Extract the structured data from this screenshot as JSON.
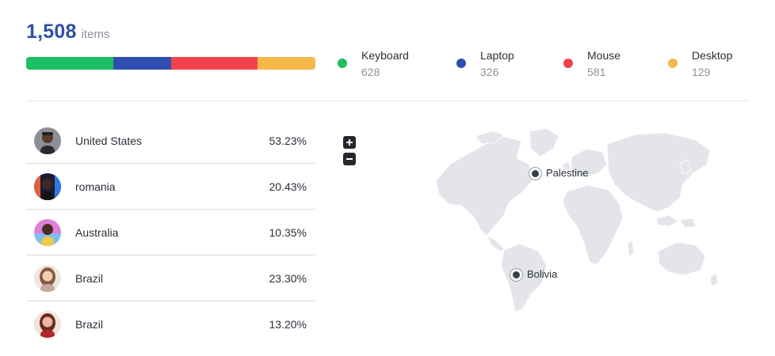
{
  "summary": {
    "total": "1,508",
    "unit": "items"
  },
  "categories": [
    {
      "label": "Keyboard",
      "count": "628",
      "color": "#1cbf63",
      "share": 0.3
    },
    {
      "label": "Laptop",
      "count": "326",
      "color": "#2e4fb0",
      "share": 0.2
    },
    {
      "label": "Mouse",
      "count": "581",
      "color": "#f2434d",
      "share": 0.3
    },
    {
      "label": "Desktop",
      "count": "129",
      "color": "#f6b84b",
      "share": 0.2
    }
  ],
  "countries": [
    {
      "name": "United States",
      "percent": "53.23%",
      "avatar": "avatar-man-gray"
    },
    {
      "name": "romania",
      "percent": "20.43%",
      "avatar": "avatar-man-neon"
    },
    {
      "name": "Australia",
      "percent": "10.35%",
      "avatar": "avatar-man-pink"
    },
    {
      "name": "Brazil",
      "percent": "23.30%",
      "avatar": "avatar-woman-light"
    },
    {
      "name": "Brazil",
      "percent": "13.20%",
      "avatar": "avatar-woman-red"
    }
  ],
  "map": {
    "zoom_in_icon": "plus-icon",
    "zoom_out_icon": "minus-icon",
    "land_color": "#e3e5ea",
    "markers": [
      {
        "label": "Palestine"
      },
      {
        "label": "Bolivia"
      }
    ]
  }
}
